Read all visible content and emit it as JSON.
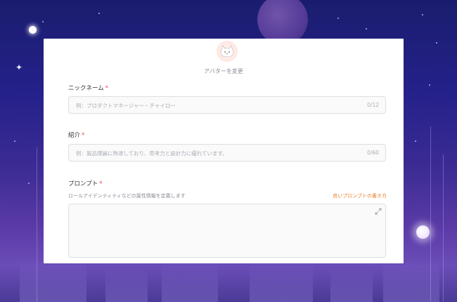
{
  "colors": {
    "accent_link": "#e8822b",
    "required_mark": "#e5484d",
    "background_top": "#1a1d6e",
    "background_bottom": "#6b4db8"
  },
  "avatar": {
    "icon": "cat-icon",
    "change_label": "アバターを変更"
  },
  "nickname": {
    "label": "ニックネーム",
    "required": "*",
    "placeholder": "例：プロダクトマネージャー・チャイロー",
    "counter": "0/12"
  },
  "intro": {
    "label": "紹介",
    "required": "*",
    "placeholder": "例：製品理論に熟達しており、思考力と設計力に優れています。",
    "counter": "0/60"
  },
  "prompt": {
    "label": "プロンプト",
    "required": "*",
    "hint": "ロールアイデンティティなどの属性情報を定義します",
    "tips_link": "良いプロンプトの書き方",
    "value": "",
    "expand_icon": "expand-icon"
  }
}
